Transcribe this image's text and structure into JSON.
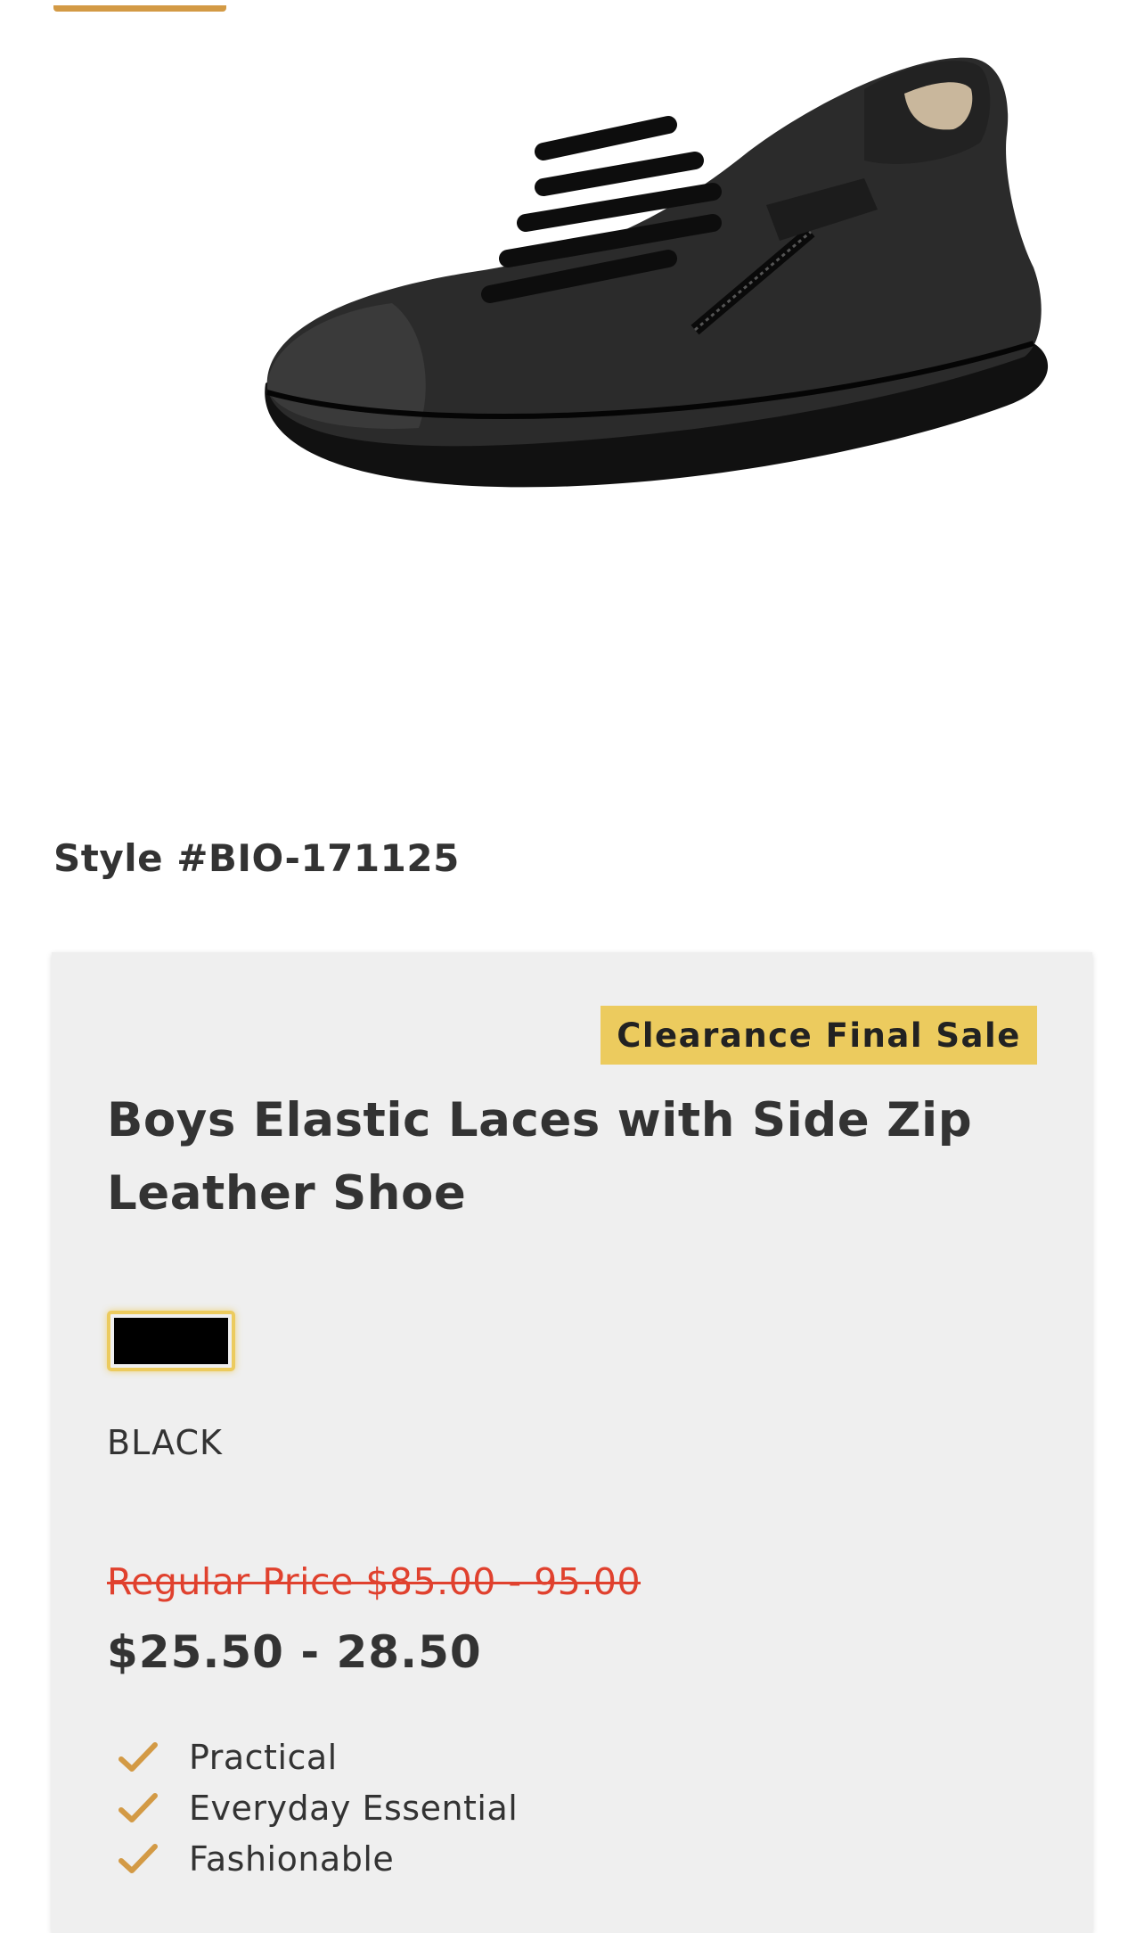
{
  "gallery": {
    "image_alt": "Black leather shoe with elastic laces and side zip"
  },
  "product": {
    "style_number": "Style #BIO-171125",
    "badge": "Clearance Final Sale",
    "title": "Boys Elastic Laces with Side Zip Leather Shoe",
    "selected_color": {
      "name": "BLACK",
      "swatch_color": "#000000"
    },
    "regular_price": "Regular Price $85.00 - 95.00",
    "sale_price": "$25.50 - 28.50",
    "features": [
      "Practical",
      "Everyday Essential",
      "Fashionable"
    ]
  },
  "colors": {
    "accent": "#d39a45",
    "badge": "#eccb5e",
    "regular_price": "#e0412e",
    "panel": "#efefef"
  },
  "icons": {
    "feature": "check-icon"
  }
}
